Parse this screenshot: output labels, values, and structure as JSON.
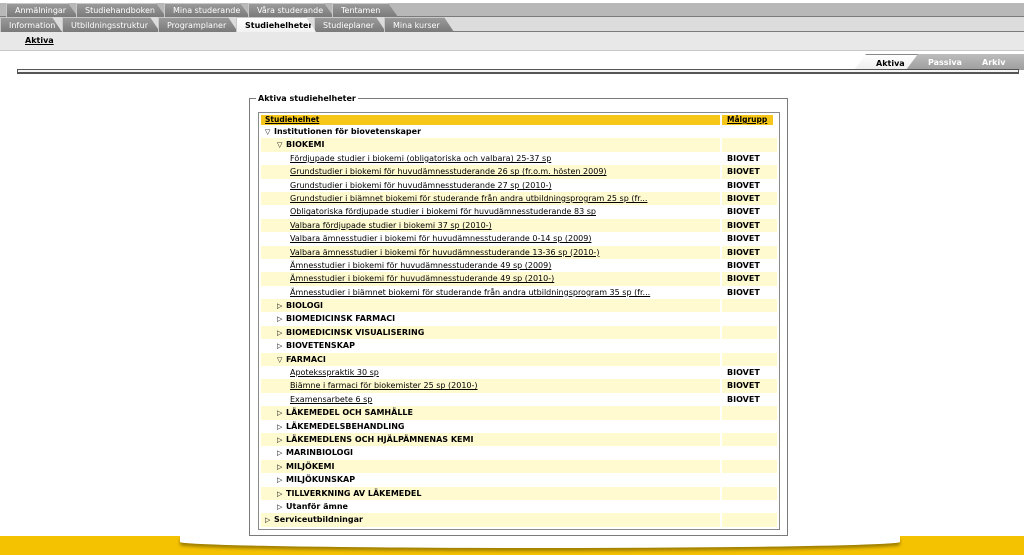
{
  "top_tabs_row1": [
    {
      "label": "Anmälningar"
    },
    {
      "label": "Studiehandboken"
    },
    {
      "label": "Mina studerande"
    },
    {
      "label": "Våra studerande"
    },
    {
      "label": "Tentamen"
    }
  ],
  "top_tabs_row2": [
    {
      "label": "Information"
    },
    {
      "label": "Utbildningsstruktur"
    },
    {
      "label": "Programplaner"
    },
    {
      "label": "Studiehelheter",
      "active": true
    },
    {
      "label": "Studieplaner"
    },
    {
      "label": "Mina kurser"
    }
  ],
  "subnav": {
    "active_link": "Aktiva"
  },
  "right_tabs": [
    {
      "label": "Aktiva",
      "active": true
    },
    {
      "label": "Passiva"
    },
    {
      "label": "Arkiv"
    }
  ],
  "panel": {
    "legend": "Aktiva studiehelheter",
    "col_studiehelhet": "Studiehelhet",
    "col_malgrupp": "Målgrupp"
  },
  "rows": [
    {
      "level": 0,
      "expanded": true,
      "label": "Institutionen för biovetenskaper",
      "group": ""
    },
    {
      "level": 1,
      "expanded": true,
      "label": "BIOKEMI",
      "group": ""
    },
    {
      "level": 2,
      "label": "Fördjupade studier i biokemi (obligatoriska och valbara) 25-37 sp",
      "group": "BIOVET"
    },
    {
      "level": 2,
      "label": "Grundstudier i biokemi för huvudämnesstuderande 26 sp (fr.o.m. hösten 2009)",
      "group": "BIOVET"
    },
    {
      "level": 2,
      "label": "Grundstudier i biokemi för huvudämnesstuderande 27 sp (2010-)",
      "group": "BIOVET"
    },
    {
      "level": 2,
      "label": "Grundstudier i biämnet biokemi för studerande från andra utbildningsprogram 25 sp (fr...",
      "group": "BIOVET"
    },
    {
      "level": 2,
      "label": "Obligatoriska fördjupade studier i biokemi för huvudämnesstuderande 83 sp",
      "group": "BIOVET"
    },
    {
      "level": 2,
      "label": "Valbara fördjupade studier i biokemi 37 sp (2010-)",
      "group": "BIOVET"
    },
    {
      "level": 2,
      "label": "Valbara ämnesstudier i biokemi för huvudämnesstuderande 0-14 sp (2009)",
      "group": "BIOVET"
    },
    {
      "level": 2,
      "label": "Valbara ämnesstudier i biokemi för huvudämnesstuderande 13-36 sp (2010-)",
      "group": "BIOVET"
    },
    {
      "level": 2,
      "label": "Ämnesstudier i biokemi för huvudämnesstuderande 49 sp (2009)",
      "group": "BIOVET"
    },
    {
      "level": 2,
      "label": "Ämnesstudier i biokemi för huvudämnesstuderande 49 sp (2010-)",
      "group": "BIOVET"
    },
    {
      "level": 2,
      "label": "Ämnesstudier i biämnet biokemi för studerande från andra utbildningsprogram 35 sp (fr...",
      "group": "BIOVET"
    },
    {
      "level": 1,
      "expanded": false,
      "label": "BIOLOGI",
      "group": ""
    },
    {
      "level": 1,
      "expanded": false,
      "label": "BIOMEDICINSK FARMACI",
      "group": ""
    },
    {
      "level": 1,
      "expanded": false,
      "label": "BIOMEDICINSK VISUALISERING",
      "group": ""
    },
    {
      "level": 1,
      "expanded": false,
      "label": "BIOVETENSKAP",
      "group": ""
    },
    {
      "level": 1,
      "expanded": true,
      "label": "FARMACI",
      "group": ""
    },
    {
      "level": 2,
      "label": "Apoteksspraktik 30 sp",
      "group": "BIOVET"
    },
    {
      "level": 2,
      "label": "Biämne i farmaci för biokemister 25 sp (2010-)",
      "group": "BIOVET"
    },
    {
      "level": 2,
      "label": "Examensarbete 6 sp",
      "group": "BIOVET"
    },
    {
      "level": 1,
      "expanded": false,
      "label": "LÄKEMEDEL OCH SAMHÄLLE",
      "group": ""
    },
    {
      "level": 1,
      "expanded": false,
      "label": "LÄKEMEDELSBEHANDLING",
      "group": ""
    },
    {
      "level": 1,
      "expanded": false,
      "label": "LÄKEMEDLENS OCH HJÄLPÄMNENAS KEMI",
      "group": ""
    },
    {
      "level": 1,
      "expanded": false,
      "label": "MARINBIOLOGI",
      "group": ""
    },
    {
      "level": 1,
      "expanded": false,
      "label": "MILJÖKEMI",
      "group": ""
    },
    {
      "level": 1,
      "expanded": false,
      "label": "MILJÖKUNSKAP",
      "group": ""
    },
    {
      "level": 1,
      "expanded": false,
      "label": "TILLVERKNING AV LÄKEMEDEL",
      "group": ""
    },
    {
      "level": 1,
      "expanded": false,
      "label": "Utanför ämne",
      "group": ""
    },
    {
      "level": 0,
      "expanded": false,
      "label": "Serviceutbildningar",
      "group": ""
    }
  ],
  "colors": {
    "header_yellow": "#f6c718",
    "row_highlight": "#fffad0",
    "banner_yellow": "#f4c200",
    "tab_gray": "#8a8a8a"
  }
}
